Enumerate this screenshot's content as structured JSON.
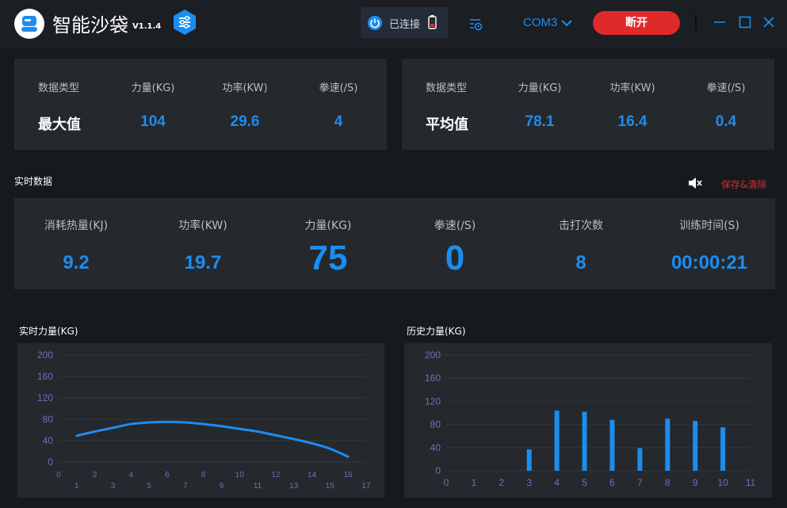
{
  "header": {
    "title": "智能沙袋",
    "version": "V1.1.4",
    "connection_status": "已连接",
    "port": "COM3",
    "disconnect_label": "断开"
  },
  "max_panel": {
    "labels": [
      "数据类型",
      "力量(KG)",
      "功率(KW)",
      "拳速(/S)"
    ],
    "type": "最大值",
    "values": [
      "104",
      "29.6",
      "4"
    ]
  },
  "avg_panel": {
    "labels": [
      "数据类型",
      "力量(KG)",
      "功率(KW)",
      "拳速(/S)"
    ],
    "type": "平均值",
    "values": [
      "78.1",
      "16.4",
      "0.4"
    ]
  },
  "realtime": {
    "section_title": "实时数据",
    "save_clear_label": "保存&清除",
    "items": [
      {
        "label": "消耗热量(KJ)",
        "value": "9.2"
      },
      {
        "label": "功率(KW)",
        "value": "19.7"
      },
      {
        "label": "力量(KG)",
        "value": "75"
      },
      {
        "label": "拳速(/S)",
        "value": "0"
      },
      {
        "label": "击打次数",
        "value": "8"
      },
      {
        "label": "训练时间(S)",
        "value": "00:00:21"
      }
    ]
  },
  "colors": {
    "accent": "#1c8df0",
    "danger": "#e02a2a",
    "panel": "#25282d",
    "background": "#16191e"
  },
  "chart_data": [
    {
      "type": "line",
      "title": "实时力量(KG)",
      "x": [
        1,
        2,
        3,
        4,
        5,
        6,
        7,
        8,
        9,
        10,
        11,
        12,
        13,
        14,
        15,
        16
      ],
      "values": [
        49,
        57,
        64,
        71,
        74,
        75,
        74,
        71,
        67,
        62,
        57,
        50,
        43,
        35,
        25,
        10
      ],
      "ylim": [
        0,
        200
      ],
      "yticks": [
        0,
        40,
        80,
        120,
        160,
        200
      ],
      "xlim": [
        0,
        17
      ],
      "xticks": [
        0,
        1,
        2,
        3,
        4,
        5,
        6,
        7,
        8,
        9,
        10,
        11,
        12,
        13,
        14,
        15,
        16,
        17
      ],
      "grid": true
    },
    {
      "type": "bar",
      "title": "历史力量(KG)",
      "categories": [
        3,
        4,
        5,
        6,
        7,
        8,
        9,
        10
      ],
      "values": [
        37,
        104,
        102,
        88,
        39,
        90,
        86,
        75
      ],
      "ylim": [
        0,
        200
      ],
      "yticks": [
        0,
        40,
        80,
        120,
        160,
        200
      ],
      "xlim": [
        0,
        11
      ],
      "xticks": [
        0,
        1,
        2,
        3,
        4,
        5,
        6,
        7,
        8,
        9,
        10,
        11
      ],
      "grid": true
    }
  ]
}
